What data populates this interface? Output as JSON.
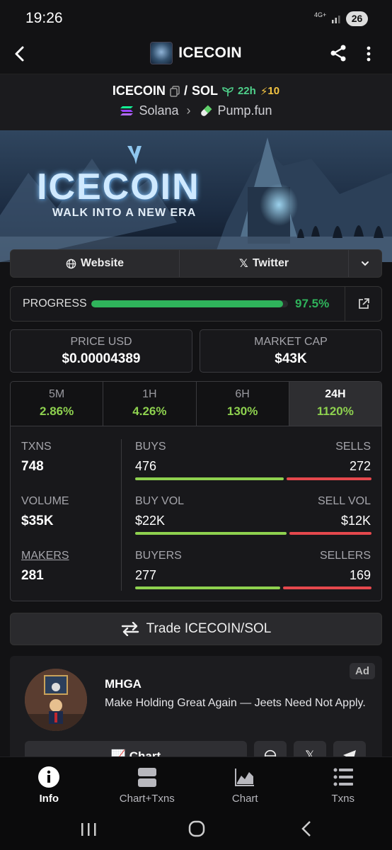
{
  "status_bar": {
    "time": "19:26",
    "network": "4G+",
    "battery": "26"
  },
  "app_bar": {
    "title": "ICECOIN",
    "back_icon": "back-arrow-icon",
    "share_icon": "share-icon",
    "menu_icon": "more-vert-icon"
  },
  "pair": {
    "base": "ICECOIN",
    "separator": "/",
    "quote": "SOL",
    "age": "22h",
    "boosts": "10",
    "chain": "Solana",
    "dex": "Pump.fun"
  },
  "banner": {
    "headline": "ICECOIN",
    "tagline": "WALK INTO A NEW ERA"
  },
  "links": {
    "website": "Website",
    "twitter": "Twitter"
  },
  "progress": {
    "label": "PROGRESS",
    "percent_text": "97.5%",
    "value": 0.975
  },
  "price": {
    "label": "PRICE USD",
    "value": "$0.00004389"
  },
  "market_cap": {
    "label": "MARKET CAP",
    "value": "$43K"
  },
  "timeframes": [
    {
      "label": "5M",
      "change": "2.86%"
    },
    {
      "label": "1H",
      "change": "4.26%"
    },
    {
      "label": "6H",
      "change": "130%"
    },
    {
      "label": "24H",
      "change": "1120%"
    }
  ],
  "stats": {
    "txns": {
      "label": "TXNS",
      "value": "748"
    },
    "volume": {
      "label": "VOLUME",
      "value": "$35K"
    },
    "makers": {
      "label": "MAKERS",
      "value": "281"
    },
    "buys": {
      "label": "BUYS",
      "value": "476",
      "count": 476
    },
    "sells": {
      "label": "SELLS",
      "value": "272",
      "count": 272
    },
    "buy_vol": {
      "label": "BUY VOL",
      "value": "$22K",
      "amount": 22
    },
    "sell_vol": {
      "label": "SELL VOL",
      "value": "$12K",
      "amount": 12
    },
    "buyers": {
      "label": "BUYERS",
      "value": "277",
      "count": 277
    },
    "sellers": {
      "label": "SELLERS",
      "value": "169",
      "count": 169
    }
  },
  "trade_button": "Trade ICECOIN/SOL",
  "ad": {
    "badge": "Ad",
    "name": "MHGA",
    "text": "Make Holding Great Again — Jeets Need Not Apply.",
    "chart_button": "Chart"
  },
  "bottom_nav": [
    {
      "label": "Info",
      "icon": "info-icon",
      "active": true
    },
    {
      "label": "Chart+Txns",
      "icon": "chart-txns-icon",
      "active": false
    },
    {
      "label": "Chart",
      "icon": "area-chart-icon",
      "active": false
    },
    {
      "label": "Txns",
      "icon": "list-icon",
      "active": false
    }
  ],
  "colors": {
    "positive": "#8ed14f",
    "negative": "#e5484d",
    "progress": "#2fb35b",
    "background": "#121214"
  }
}
